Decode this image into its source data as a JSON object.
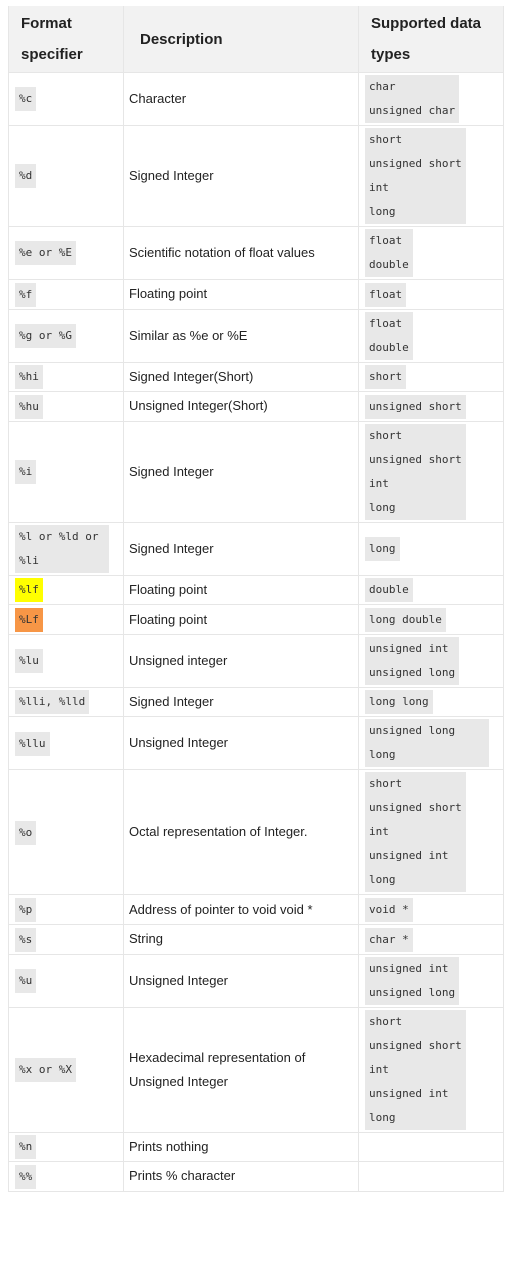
{
  "headers": {
    "specifier": "Format specifier",
    "description": "Description",
    "types": "Supported data types"
  },
  "rows": [
    {
      "spec": "%c",
      "desc": "Character",
      "types": [
        "char",
        "unsigned char"
      ]
    },
    {
      "spec": "%d",
      "desc": "Signed Integer",
      "types": [
        "short",
        "unsigned short",
        "int",
        "long"
      ]
    },
    {
      "spec": "%e or %E",
      "desc": "Scientific notation of float values",
      "types": [
        "float",
        "double"
      ]
    },
    {
      "spec": "%f",
      "desc": "Floating point",
      "types": [
        "float"
      ]
    },
    {
      "spec": "%g or %G",
      "desc": "Similar as %e or %E",
      "types": [
        "float",
        "double"
      ]
    },
    {
      "spec": "%hi",
      "desc": "Signed Integer(Short)",
      "types": [
        "short"
      ]
    },
    {
      "spec": "%hu",
      "desc": "Unsigned Integer(Short)",
      "types": [
        "unsigned short"
      ]
    },
    {
      "spec": "%i",
      "desc": "Signed Integer",
      "types": [
        "short",
        "unsigned short",
        "int",
        "long"
      ]
    },
    {
      "spec": "%l or %ld or %li",
      "desc": "Signed Integer",
      "types": [
        "long"
      ]
    },
    {
      "spec": "%lf",
      "desc": "Floating point",
      "types": [
        "double"
      ],
      "highlight": "#ffff00"
    },
    {
      "spec": "%Lf",
      "desc": "Floating point",
      "types": [
        "long double"
      ],
      "highlight": "#f79646"
    },
    {
      "spec": "%lu",
      "desc": "Unsigned integer",
      "types": [
        "unsigned int",
        "unsigned long"
      ]
    },
    {
      "spec": "%lli, %lld",
      "desc": "Signed Integer",
      "types": [
        "long long"
      ]
    },
    {
      "spec": "%llu",
      "desc": "Unsigned Integer",
      "types": [
        "unsigned long long"
      ]
    },
    {
      "spec": "%o",
      "desc": "Octal representation of Integer.",
      "types": [
        "short",
        "unsigned short",
        "int",
        "unsigned int",
        "long"
      ]
    },
    {
      "spec": "%p",
      "desc": "Address of pointer to void void *",
      "types": [
        "void *"
      ]
    },
    {
      "spec": "%s",
      "desc": "String",
      "types": [
        "char *"
      ]
    },
    {
      "spec": "%u",
      "desc": "Unsigned Integer",
      "types": [
        "unsigned int",
        "unsigned long"
      ]
    },
    {
      "spec": "%x or %X",
      "desc": "Hexadecimal representation of Unsigned Integer",
      "types": [
        "short",
        "unsigned short",
        "int",
        "unsigned int",
        "long"
      ]
    },
    {
      "spec": "%n",
      "desc": "Prints nothing",
      "types": []
    },
    {
      "spec": "%%",
      "desc": "Prints % character",
      "types": []
    }
  ]
}
